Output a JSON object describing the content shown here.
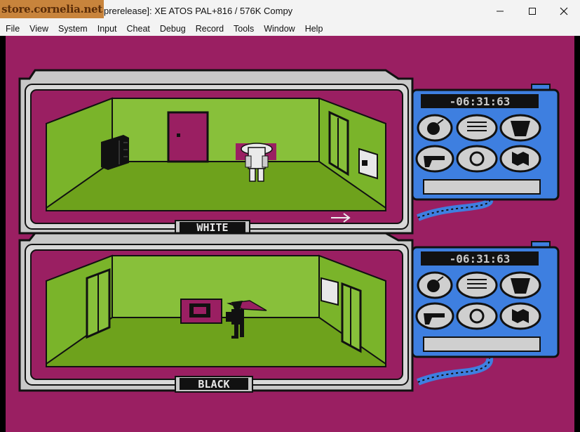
{
  "window": {
    "logo_text": "store.cornelia.net",
    "title": "prerelease]: XE ATOS PAL+816 / 576K Compy",
    "minimize_icon": "minimize-icon",
    "maximize_icon": "maximize-icon",
    "close_icon": "close-icon"
  },
  "menu": [
    "File",
    "View",
    "System",
    "Input",
    "Cheat",
    "Debug",
    "Record",
    "Tools",
    "Window",
    "Help"
  ],
  "game": {
    "top_panel": {
      "label": "WHITE",
      "timer": "-06:31:63"
    },
    "bottom_panel": {
      "label": "BLACK",
      "timer": "-06:31:63"
    },
    "trap_icons": [
      "bomb-icon",
      "spring-icon",
      "bucket-icon",
      "gun-icon",
      "time-bomb-icon",
      "map-icon"
    ],
    "colors": {
      "background": "#9a1f62",
      "floor": "#6ea21c",
      "wall": "#88c03a",
      "frame": "#c8c8c8",
      "console": "#3e7fe0"
    }
  }
}
